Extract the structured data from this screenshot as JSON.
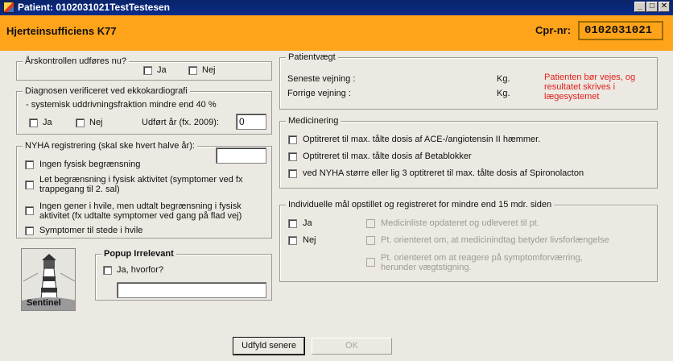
{
  "window": {
    "title": "Patient: 0102031021TestTestesen"
  },
  "header": {
    "title": "Hjerteinsufficiens K77",
    "cpr_label": "Cpr-nr:",
    "cpr_value": "0102031021"
  },
  "arskontrol": {
    "legend": "Årskontrollen udføres nu?",
    "ja": "Ja",
    "nej": "Nej"
  },
  "diagnose": {
    "legend": "Diagnosen verificeret ved ekkokardiografi",
    "subline": "- systemisk uddrivningsfraktion mindre end 40 %",
    "ja": "Ja",
    "nej": "Nej",
    "year_label": "Udført år (fx. 2009):",
    "year_value": "0"
  },
  "nyha": {
    "legend": "NYHA registrering (skal ske hvert halve år):",
    "field_value": "",
    "options": [
      "Ingen fysisk begrænsning",
      "Let begrænsning i fysisk aktivitet (symptomer ved fx",
      "trappegang til 2. sal)",
      "Ingen gener i hvile, men udtalt begrænsning i fysisk",
      "aktivitet (fx udtalte symptomer ved gang på flad vej)",
      "Symptomer til stede i hvile"
    ]
  },
  "popup": {
    "legend": "Popup Irrelevant",
    "ja_hvorfor": "Ja, hvorfor?",
    "reason_value": ""
  },
  "logo": {
    "text": "Sentinel"
  },
  "vaegt": {
    "legend": "Patientvægt",
    "seneste": "Seneste vejning :",
    "forrige": "Forrige vejning :",
    "unit": "Kg.",
    "note_lines": [
      "Patienten bør vejes, og",
      "resultatet skrives i",
      "lægesystemet"
    ]
  },
  "medicin": {
    "legend": "Medicinering",
    "items": [
      "Optitreret til max. tålte dosis af ACE-/angiotensin II hæmmer.",
      "Optitreret til max. tålte dosis af Betablokker",
      "ved NYHA større eller lig 3 optitreret til max. tålte dosis af Spironolacton"
    ]
  },
  "maal": {
    "legend": "Individuelle mål opstillet og registreret for mindre end 15 mdr. siden",
    "ja": "Ja",
    "nej": "Nej",
    "items": [
      "Medicinliste opdateret og udleveret til pt.",
      "Pt. orienteret om, at medicinindtag betyder livsforlængelse",
      "Pt. orienteret om at reagere på symptomforværring,",
      "herunder vægtstigning."
    ]
  },
  "buttons": {
    "later": "Udfyld senere",
    "ok": "OK"
  },
  "colors": {
    "header_bg": "#ffa31a",
    "titlebar_bg": "#0a246a",
    "note_red": "#e0201c"
  }
}
